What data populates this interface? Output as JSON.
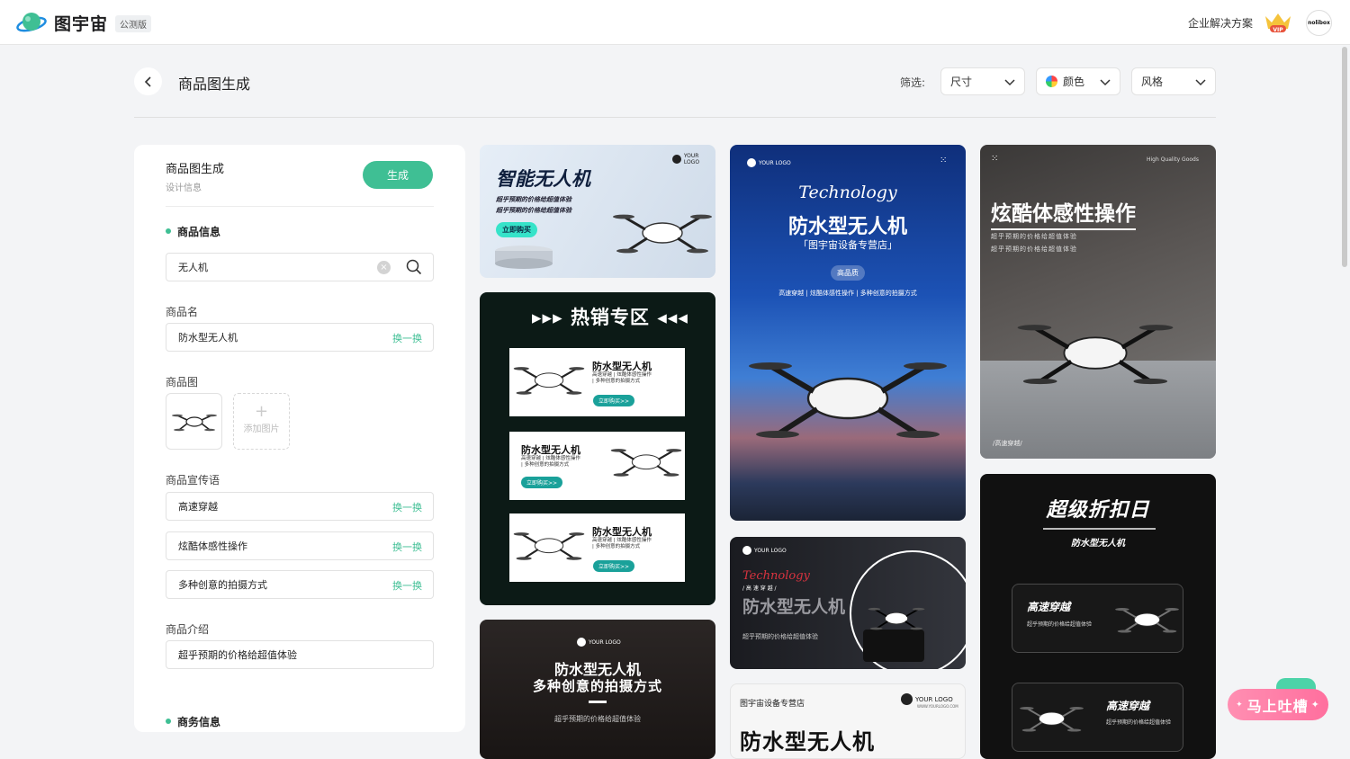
{
  "topbar": {
    "brand": "图宇宙",
    "beta_badge": "公测版",
    "enterprise": "企业解决方案",
    "vip": "VIP",
    "avatar": "nolibox"
  },
  "header": {
    "title": "商品图生成",
    "filter_label": "筛选:",
    "filters": {
      "size": "尺寸",
      "color": "颜色",
      "style": "风格"
    }
  },
  "panel": {
    "title": "商品图生成",
    "subtitle": "设计信息",
    "generate": "生成",
    "section_product": "商品信息",
    "search_value": "无人机",
    "name_label": "商品名",
    "name_value": "防水型无人机",
    "swap": "换一换",
    "image_label": "商品图",
    "add_image": "添加图片",
    "slogan_label": "商品宣传语",
    "slogans": [
      "高速穿越",
      "炫酷体感性操作",
      "多种创意的拍摄方式"
    ],
    "intro_label": "商品介绍",
    "intro_value": "超乎预期的价格给超值体验",
    "section_business": "商务信息"
  },
  "cards": {
    "c1": {
      "logo": "YOUR LOGO",
      "title": "智能无人机",
      "line1": "超乎预期的价格给超值体验",
      "line2": "超乎预期的价格给超值体验",
      "button": "立即购买"
    },
    "c2": {
      "title": "热销专区",
      "items": [
        {
          "title": "防水型无人机",
          "sub1": "高速穿越 | 炫酷体感性操作",
          "sub2": "| 多种创意的拍摄方式",
          "button": "立即购买>>"
        },
        {
          "title": "防水型无人机",
          "sub1": "高速穿越 | 炫酷体感性操作",
          "sub2": "| 多种创意的拍摄方式",
          "button": "立即购买>>"
        },
        {
          "title": "防水型无人机",
          "sub1": "高速穿越 | 炫酷体感性操作",
          "sub2": "| 多种创意的拍摄方式",
          "button": "立即购买>>"
        }
      ]
    },
    "c3": {
      "logo": "YOUR LOGO",
      "title1": "防水型无人机",
      "title2": "多种创意的拍摄方式",
      "sub": "超乎预期的价格给超值体验"
    },
    "c4": {
      "logo": "YOUR LOGO",
      "script": "Technology",
      "title": "防水型无人机",
      "store": "「图宇宙设备专营店」",
      "badge": "高品质",
      "features": "高速穿越 | 炫酷体感性操作 | 多种创意的拍摄方式"
    },
    "c5": {
      "logo": "YOUR LOGO",
      "script": "Technology",
      "tag": "/ 高 速 穿 越 /",
      "title": "防水型无人机",
      "sub": "超乎预期的价格给超值体验"
    },
    "c6": {
      "store": "图宇宙设备专营店",
      "logo": "YOUR LOGO",
      "url": "WWW.YOURLOGO.COM",
      "title": "防水型无人机"
    },
    "c7": {
      "tagline": "High Quality Goods",
      "title": "炫酷体感性操作",
      "line1": "超乎预期的价格给超值体验",
      "line2": "超乎预期的价格给超值体验",
      "tag": "/高速穿越/"
    },
    "c8": {
      "title": "超级折扣日",
      "sub": "防水型无人机",
      "box1_title": "高速穿越",
      "box1_sub": "超乎预期的价格给超值体验",
      "box2_title": "高速穿越",
      "box2_sub": "超乎预期的价格给超值体验"
    }
  },
  "feedback": "马上吐槽",
  "colors": {
    "accent": "#3fbf94",
    "feedback": "#ff7aa6"
  }
}
